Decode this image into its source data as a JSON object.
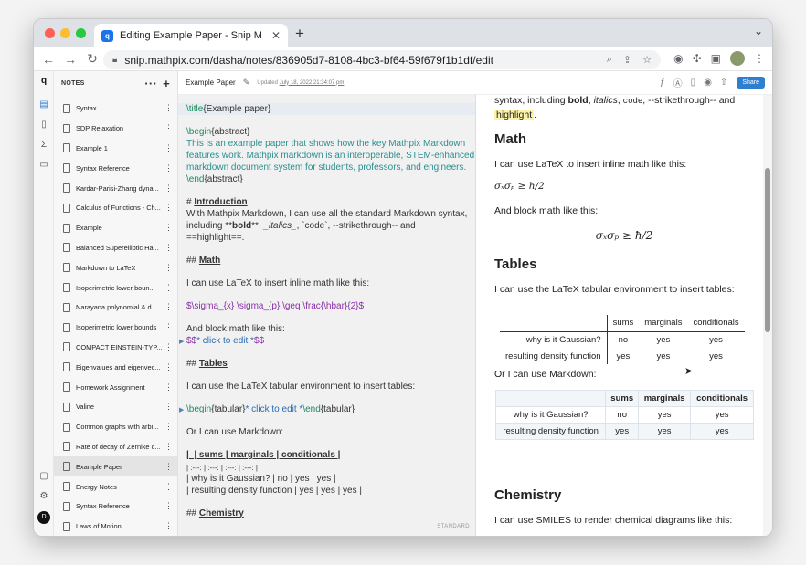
{
  "browser": {
    "tab_title": "Editing Example Paper - Snip M",
    "tab_close": "✕",
    "new_tab": "+",
    "url": "snip.mathpix.com/dasha/notes/836905d7-8108-4bc3-bf64-59f679f1b1df/edit",
    "favicon_letter": "q"
  },
  "sidebar": {
    "header": "NOTES",
    "items": [
      {
        "label": "Syntax"
      },
      {
        "label": "SDP Relaxation"
      },
      {
        "label": "Example 1"
      },
      {
        "label": "Syntax Reference"
      },
      {
        "label": "Kardar-Parisi-Zhang dyna..."
      },
      {
        "label": "Calculus of Functions - Ch..."
      },
      {
        "label": "Example"
      },
      {
        "label": "Balanced Superelliptic Ha..."
      },
      {
        "label": "Markdown to LaTeX"
      },
      {
        "label": "Isoperimetric lower boun..."
      },
      {
        "label": "Narayana polynomial & d..."
      },
      {
        "label": "Isoperimetric lower bounds"
      },
      {
        "label": "COMPACT EINSTEIN-TYP..."
      },
      {
        "label": "Eigenvalues and eigenvec..."
      },
      {
        "label": "Homework Assignment"
      },
      {
        "label": "Valine"
      },
      {
        "label": "Common graphs with arbi..."
      },
      {
        "label": "Rate of decay of Zernike c..."
      },
      {
        "label": "Example Paper"
      },
      {
        "label": "Energy Notes"
      },
      {
        "label": "Syntax Reference"
      },
      {
        "label": "Laws of Motion"
      }
    ],
    "active_index": 18
  },
  "docbar": {
    "title": "Example Paper",
    "updated_label": "Updated",
    "updated_date": "July 18, 2022 21:34:07 pm",
    "share": "Share"
  },
  "editor": {
    "l_title": [
      "\\title",
      "{Example paper}"
    ],
    "l_begin_abs": [
      "\\begin",
      "{abstract}"
    ],
    "l_abs1": "This is an example paper that shows how the key Mathpix Markdown",
    "l_abs2": "features work. Mathpix markdown is an interoperable, STEM-enhanced",
    "l_abs3": "markdown document system for students, professors, and engineers.",
    "l_end_abs": [
      "\\end",
      "{abstract}"
    ],
    "intro_hash": "# ",
    "intro": "Introduction",
    "intro1": "With Mathpix Markdown, I can use all the standard Markdown syntax,",
    "intro2a": "including **",
    "intro2b": "bold",
    "intro2c": "**, ",
    "intro2d": "_italics_",
    "intro2e": ", `code`, --strikethrough-- and",
    "intro3": "==highlight==.",
    "math_hash": "## ",
    "math": "Math",
    "math1": "I can use LaTeX to insert inline math like this:",
    "math2a": "$\\sigma",
    "math2b": "_{x} \\sigma",
    "math2c": "_{p} \\geq \\frac",
    "math2d": "{\\hbar}",
    "math2e": "{2}$",
    "math3": "And block math like this:",
    "math4a": "$$",
    "math4b": "* click to edit *",
    "math4c": "$$",
    "tables_hash": "## ",
    "tables": "Tables",
    "tab1": "I can use the LaTeX tabular environment to insert tables:",
    "tab2a": "\\begin",
    "tab2b": "{tabular}",
    "tab2c": "* click to edit *",
    "tab2d": "\\end",
    "tab2e": "{tabular}",
    "md1": "Or I can use Markdown:",
    "md2": "|_| sums | marginals | conditionals |",
    "md3": "| :---: | :---: | :---: | :---: |",
    "md4": "| why is it Gaussian? | no | yes | yes |",
    "md5": "| resulting density function | yes | yes | yes |",
    "chem_hash": "## ",
    "chem": "Chemistry",
    "mode": "STANDARD"
  },
  "preview": {
    "top1a": "syntax, including ",
    "top1b": "bold",
    "top1c": ", ",
    "top1d": "italics",
    "top1e": ", ",
    "top1f": "code",
    "top1g": ", --strikethrough-- and",
    "top2": "highlight",
    "top2b": ".",
    "math_h": "Math",
    "math_p1": "I can use LaTeX to insert inline math like this:",
    "math_inline": "σₓσₚ ≥ ħ/2",
    "math_p2": "And block math like this:",
    "math_block": "σₓσₚ ≥ ħ/2",
    "tables_h": "Tables",
    "tables_p1": "I can use the LaTeX tabular environment to insert tables:",
    "t1_head": [
      "",
      "sums",
      "marginals",
      "conditionals"
    ],
    "t1_rows": [
      [
        "why is it Gaussian?",
        "no",
        "yes",
        "yes"
      ],
      [
        "resulting density function",
        "yes",
        "yes",
        "yes"
      ]
    ],
    "md_p": "Or I can use Markdown:",
    "t2_head": [
      "",
      "sums",
      "marginals",
      "conditionals"
    ],
    "t2_rows": [
      [
        "why is it Gaussian?",
        "no",
        "yes",
        "yes"
      ],
      [
        "resulting density function",
        "yes",
        "yes",
        "yes"
      ]
    ],
    "chem_h": "Chemistry",
    "chem_p": "I can use SMILES to render chemical diagrams like this:"
  }
}
